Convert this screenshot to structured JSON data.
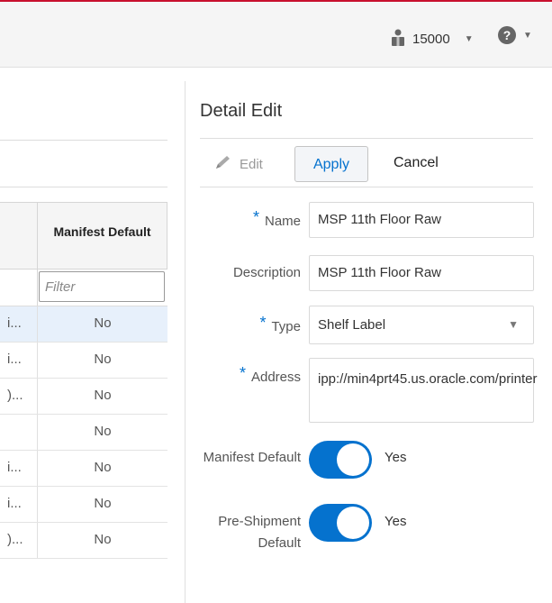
{
  "header": {
    "user_label": "15000",
    "help_symbol": "?",
    "accent_color": "#c8102e"
  },
  "table": {
    "column_header": "Manifest Default",
    "filter_placeholder": "Filter",
    "rows": [
      {
        "c1": "i...",
        "c2": "No"
      },
      {
        "c1": "i...",
        "c2": "No"
      },
      {
        "c1": ")...",
        "c2": "No"
      },
      {
        "c1": "",
        "c2": "No"
      },
      {
        "c1": "i...",
        "c2": "No"
      },
      {
        "c1": "i...",
        "c2": "No"
      },
      {
        "c1": ")...",
        "c2": "No"
      }
    ]
  },
  "detail": {
    "title": "Detail Edit",
    "toolbar": {
      "edit_label": "Edit",
      "apply_label": "Apply",
      "cancel_label": "Cancel"
    },
    "required_marker": "*",
    "fields": {
      "name_label": "Name",
      "name_value": "MSP 11th Floor Raw",
      "description_label": "Description",
      "description_value": "MSP 11th Floor Raw",
      "type_label": "Type",
      "type_value": "Shelf Label",
      "address_label": "Address",
      "address_value": "ipp://min4prt45.us.oracle.com/printer",
      "manifest_label": "Manifest Default",
      "manifest_value": "Yes",
      "manifest_on": true,
      "preship_label": "Pre-Shipment Default",
      "preship_value": "Yes",
      "preship_on": true
    },
    "accent_color": "#0572ce"
  }
}
